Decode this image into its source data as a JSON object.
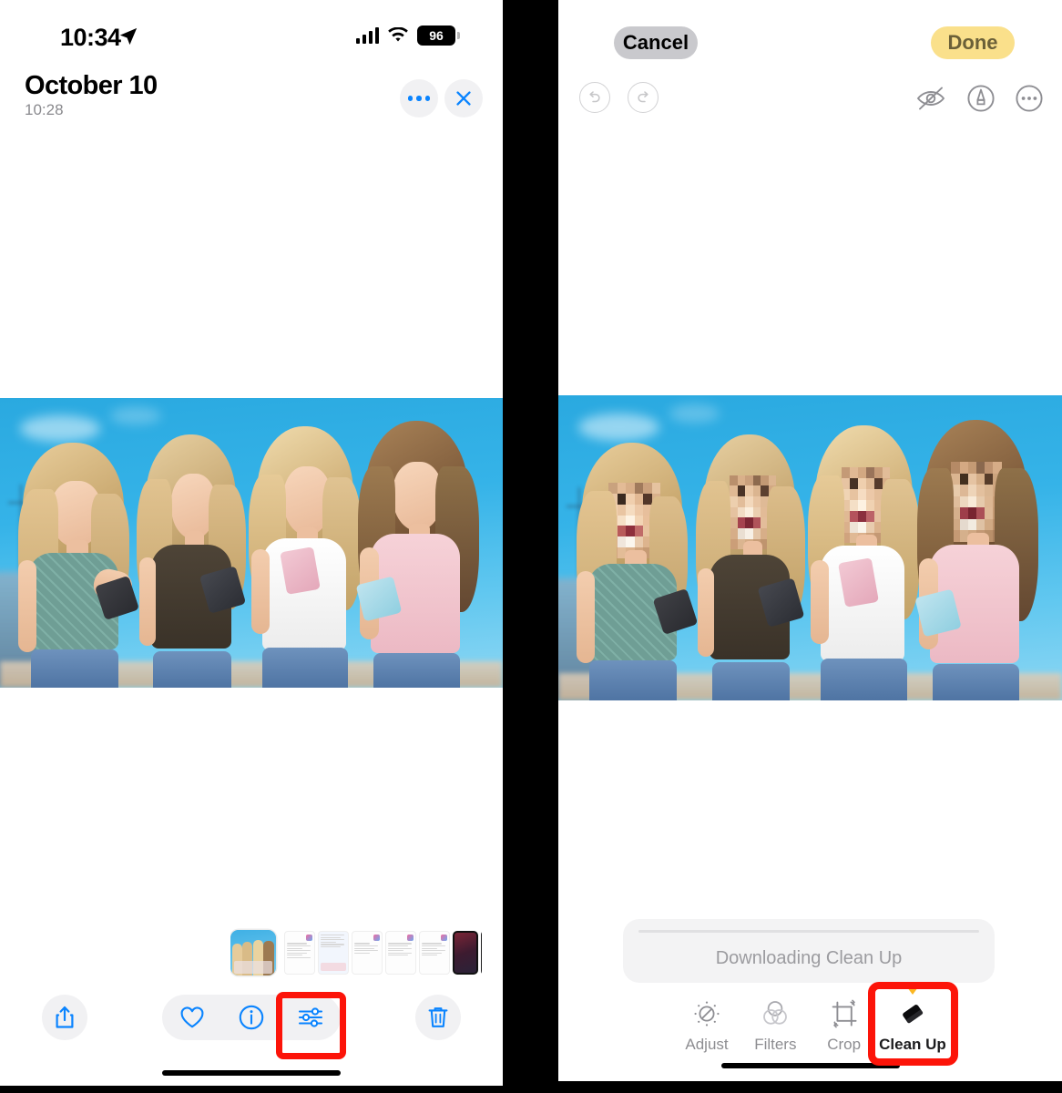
{
  "left_panel": {
    "status_bar": {
      "time": "10:34",
      "location_icon": "location-arrow-icon",
      "signal_icon": "cellular-signal-icon",
      "wifi_icon": "wifi-icon",
      "battery_level": "96"
    },
    "header": {
      "title": "October 10",
      "subtitle": "10:28",
      "more_button": "more-options-icon",
      "close_button": "close-icon"
    },
    "filmstrip": {
      "selected_index": 0,
      "thumbnails": [
        {
          "type": "photo",
          "name": "four-women-with-phones"
        },
        {
          "type": "document",
          "name": "document-screenshot-1"
        },
        {
          "type": "document-blue",
          "name": "document-screenshot-2"
        },
        {
          "type": "document-pink",
          "name": "document-screenshot-3"
        },
        {
          "type": "document",
          "name": "document-screenshot-4"
        },
        {
          "type": "document",
          "name": "document-screenshot-5"
        },
        {
          "type": "document",
          "name": "document-screenshot-6"
        },
        {
          "type": "iphone-product",
          "name": "iphone-product-screenshot"
        },
        {
          "type": "iphone-dark",
          "name": "iphone-dark-screenshot"
        },
        {
          "type": "iphone-dark-fade",
          "name": "iphone-dark-screenshot-partial"
        }
      ]
    },
    "toolbar": {
      "share_label": "share-icon",
      "favorite_label": "heart-icon",
      "info_label": "info-icon",
      "edit_label": "adjust-sliders-icon",
      "delete_label": "trash-icon"
    },
    "highlight": {
      "target": "edit-sliders-button",
      "color": "#FC1409"
    }
  },
  "right_panel": {
    "header": {
      "cancel_label": "Cancel",
      "done_label": "Done",
      "cancel_bg": "#C9C9CD",
      "done_bg": "#FAE08B"
    },
    "tools_top": {
      "undo": "undo-icon",
      "redo": "redo-icon",
      "hide": "eye-slash-icon",
      "markup": "markup-pen-icon",
      "more": "more-options-icon"
    },
    "download": {
      "label": "Downloading Clean Up",
      "progress_percent": 0
    },
    "edit_tabs": [
      {
        "label": "Adjust",
        "icon": "adjust-dial-icon",
        "active": false
      },
      {
        "label": "Filters",
        "icon": "filters-circles-icon",
        "active": false
      },
      {
        "label": "Crop",
        "icon": "crop-rotate-icon",
        "active": false
      },
      {
        "label": "Clean Up",
        "icon": "eraser-icon",
        "active": true
      }
    ],
    "highlight": {
      "target": "clean-up-tab",
      "color": "#FC1409"
    }
  },
  "photo": {
    "description": "Four young women standing outdoors under a blue sky looking at their smartphones",
    "left_version": "original",
    "right_version": "faces-pixelated",
    "subject_count": 4
  }
}
